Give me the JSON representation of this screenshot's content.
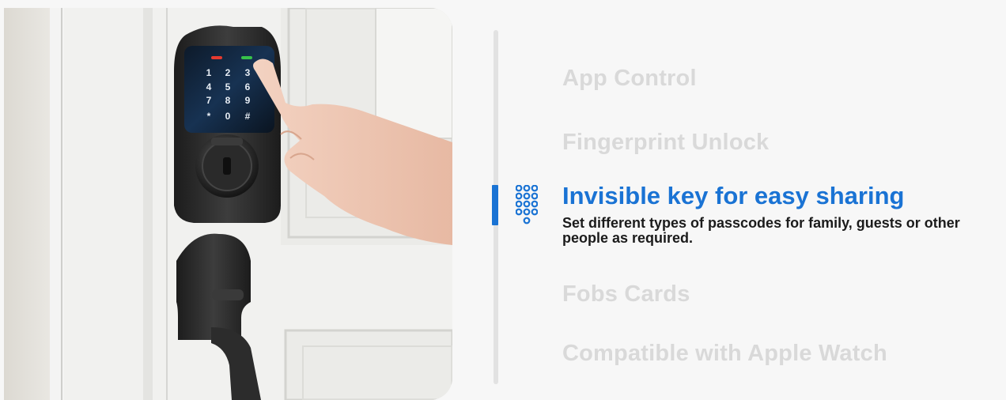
{
  "keypad_digits": [
    "1",
    "2",
    "3",
    "4",
    "5",
    "6",
    "7",
    "8",
    "9",
    "*",
    "0",
    "#"
  ],
  "features": [
    {
      "label": "App Control",
      "active": false
    },
    {
      "label": "Fingerprint Unlock",
      "active": false
    },
    {
      "label": "Invisible key for easy sharing",
      "active": true,
      "description": "Set different types of passcodes for family, guests or other people as required.",
      "icon": "keypad-icon"
    },
    {
      "label": "Fobs Cards",
      "active": false
    },
    {
      "label": "Compatible with Apple Watch",
      "active": false
    }
  ],
  "colors": {
    "accent": "#1a73d4",
    "inactive": "#d9d9d9",
    "track": "#e2e2e2",
    "lock_finish": "#2a2a2a"
  }
}
